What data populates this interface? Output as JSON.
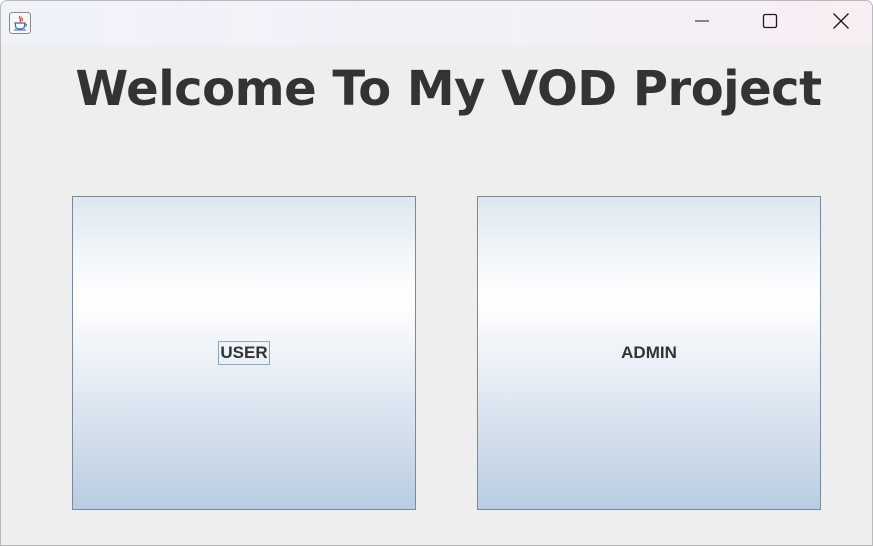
{
  "window": {
    "app_icon": "java-cup-icon",
    "controls": {
      "minimize_icon": "minimize-icon",
      "maximize_icon": "maximize-icon",
      "close_icon": "close-icon"
    }
  },
  "main": {
    "title": "Welcome To My VOD Project",
    "user_button_label": "USER",
    "admin_button_label": "ADMIN",
    "focused_button": "USER"
  },
  "colors": {
    "window_bg": "#eeeeee",
    "title_text": "#333333",
    "button_border": "#7a8a9e",
    "button_gradient_bottom": "#b8cde3"
  }
}
